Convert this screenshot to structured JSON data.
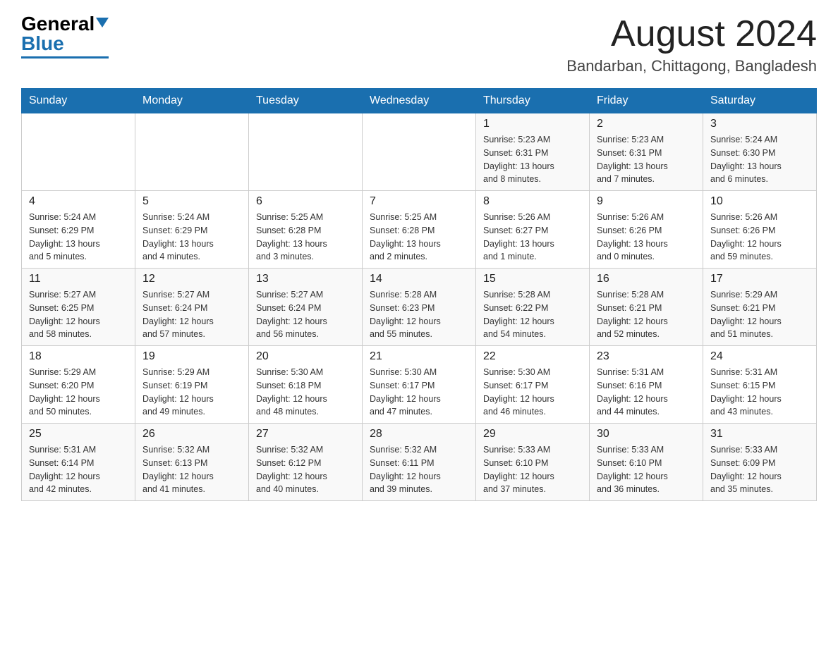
{
  "header": {
    "logo_general": "General",
    "logo_blue": "Blue",
    "month_title": "August 2024",
    "location": "Bandarban, Chittagong, Bangladesh"
  },
  "weekdays": [
    "Sunday",
    "Monday",
    "Tuesday",
    "Wednesday",
    "Thursday",
    "Friday",
    "Saturday"
  ],
  "weeks": [
    [
      {
        "day": "",
        "info": ""
      },
      {
        "day": "",
        "info": ""
      },
      {
        "day": "",
        "info": ""
      },
      {
        "day": "",
        "info": ""
      },
      {
        "day": "1",
        "info": "Sunrise: 5:23 AM\nSunset: 6:31 PM\nDaylight: 13 hours\nand 8 minutes."
      },
      {
        "day": "2",
        "info": "Sunrise: 5:23 AM\nSunset: 6:31 PM\nDaylight: 13 hours\nand 7 minutes."
      },
      {
        "day": "3",
        "info": "Sunrise: 5:24 AM\nSunset: 6:30 PM\nDaylight: 13 hours\nand 6 minutes."
      }
    ],
    [
      {
        "day": "4",
        "info": "Sunrise: 5:24 AM\nSunset: 6:29 PM\nDaylight: 13 hours\nand 5 minutes."
      },
      {
        "day": "5",
        "info": "Sunrise: 5:24 AM\nSunset: 6:29 PM\nDaylight: 13 hours\nand 4 minutes."
      },
      {
        "day": "6",
        "info": "Sunrise: 5:25 AM\nSunset: 6:28 PM\nDaylight: 13 hours\nand 3 minutes."
      },
      {
        "day": "7",
        "info": "Sunrise: 5:25 AM\nSunset: 6:28 PM\nDaylight: 13 hours\nand 2 minutes."
      },
      {
        "day": "8",
        "info": "Sunrise: 5:26 AM\nSunset: 6:27 PM\nDaylight: 13 hours\nand 1 minute."
      },
      {
        "day": "9",
        "info": "Sunrise: 5:26 AM\nSunset: 6:26 PM\nDaylight: 13 hours\nand 0 minutes."
      },
      {
        "day": "10",
        "info": "Sunrise: 5:26 AM\nSunset: 6:26 PM\nDaylight: 12 hours\nand 59 minutes."
      }
    ],
    [
      {
        "day": "11",
        "info": "Sunrise: 5:27 AM\nSunset: 6:25 PM\nDaylight: 12 hours\nand 58 minutes."
      },
      {
        "day": "12",
        "info": "Sunrise: 5:27 AM\nSunset: 6:24 PM\nDaylight: 12 hours\nand 57 minutes."
      },
      {
        "day": "13",
        "info": "Sunrise: 5:27 AM\nSunset: 6:24 PM\nDaylight: 12 hours\nand 56 minutes."
      },
      {
        "day": "14",
        "info": "Sunrise: 5:28 AM\nSunset: 6:23 PM\nDaylight: 12 hours\nand 55 minutes."
      },
      {
        "day": "15",
        "info": "Sunrise: 5:28 AM\nSunset: 6:22 PM\nDaylight: 12 hours\nand 54 minutes."
      },
      {
        "day": "16",
        "info": "Sunrise: 5:28 AM\nSunset: 6:21 PM\nDaylight: 12 hours\nand 52 minutes."
      },
      {
        "day": "17",
        "info": "Sunrise: 5:29 AM\nSunset: 6:21 PM\nDaylight: 12 hours\nand 51 minutes."
      }
    ],
    [
      {
        "day": "18",
        "info": "Sunrise: 5:29 AM\nSunset: 6:20 PM\nDaylight: 12 hours\nand 50 minutes."
      },
      {
        "day": "19",
        "info": "Sunrise: 5:29 AM\nSunset: 6:19 PM\nDaylight: 12 hours\nand 49 minutes."
      },
      {
        "day": "20",
        "info": "Sunrise: 5:30 AM\nSunset: 6:18 PM\nDaylight: 12 hours\nand 48 minutes."
      },
      {
        "day": "21",
        "info": "Sunrise: 5:30 AM\nSunset: 6:17 PM\nDaylight: 12 hours\nand 47 minutes."
      },
      {
        "day": "22",
        "info": "Sunrise: 5:30 AM\nSunset: 6:17 PM\nDaylight: 12 hours\nand 46 minutes."
      },
      {
        "day": "23",
        "info": "Sunrise: 5:31 AM\nSunset: 6:16 PM\nDaylight: 12 hours\nand 44 minutes."
      },
      {
        "day": "24",
        "info": "Sunrise: 5:31 AM\nSunset: 6:15 PM\nDaylight: 12 hours\nand 43 minutes."
      }
    ],
    [
      {
        "day": "25",
        "info": "Sunrise: 5:31 AM\nSunset: 6:14 PM\nDaylight: 12 hours\nand 42 minutes."
      },
      {
        "day": "26",
        "info": "Sunrise: 5:32 AM\nSunset: 6:13 PM\nDaylight: 12 hours\nand 41 minutes."
      },
      {
        "day": "27",
        "info": "Sunrise: 5:32 AM\nSunset: 6:12 PM\nDaylight: 12 hours\nand 40 minutes."
      },
      {
        "day": "28",
        "info": "Sunrise: 5:32 AM\nSunset: 6:11 PM\nDaylight: 12 hours\nand 39 minutes."
      },
      {
        "day": "29",
        "info": "Sunrise: 5:33 AM\nSunset: 6:10 PM\nDaylight: 12 hours\nand 37 minutes."
      },
      {
        "day": "30",
        "info": "Sunrise: 5:33 AM\nSunset: 6:10 PM\nDaylight: 12 hours\nand 36 minutes."
      },
      {
        "day": "31",
        "info": "Sunrise: 5:33 AM\nSunset: 6:09 PM\nDaylight: 12 hours\nand 35 minutes."
      }
    ]
  ]
}
